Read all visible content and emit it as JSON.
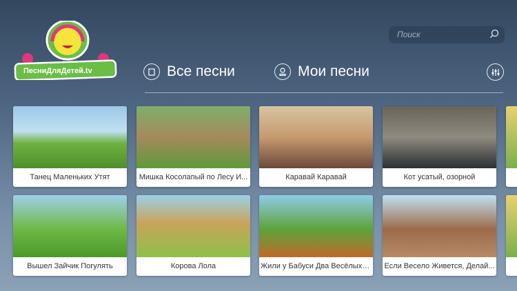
{
  "logo": {
    "text": "ПесниДляДетей.tv"
  },
  "search": {
    "placeholder": "Поиск"
  },
  "tabs": [
    {
      "label": "Все песни",
      "icon": "film-icon"
    },
    {
      "label": "Мои песни",
      "icon": "user-icon"
    }
  ],
  "settings": {
    "icon": "equalizer-icon"
  },
  "songs": [
    {
      "title": "Танец Маленьких Утят"
    },
    {
      "title": "Мишка Косолапый по Лесу И..."
    },
    {
      "title": "Каравай Каравай"
    },
    {
      "title": "Кот усатый, озорной"
    },
    {
      "title": "Вышел Зайчик Погулять"
    },
    {
      "title": "Корова Лола"
    },
    {
      "title": "Жили у Бабуси Два Весёлых Г..."
    },
    {
      "title": "Если Весело Живется, Делай..."
    }
  ]
}
